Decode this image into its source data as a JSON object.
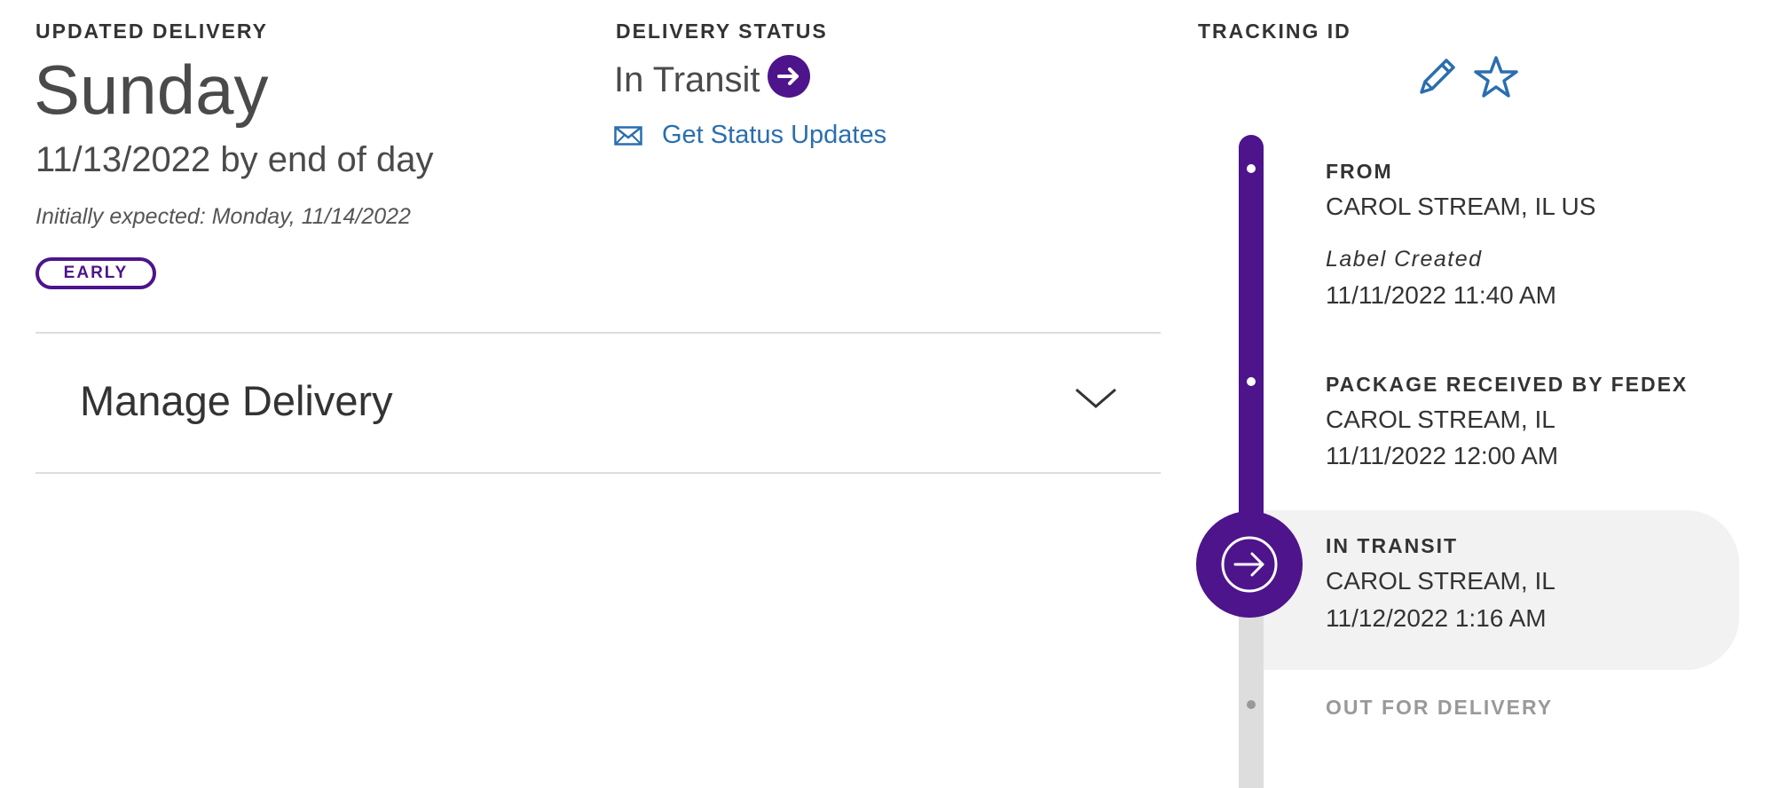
{
  "delivery": {
    "label": "UPDATED DELIVERY",
    "day": "Sunday",
    "date_line": "11/13/2022 by end of day",
    "initially_expected": "Initially expected: Monday, 11/14/2022",
    "badge": "EARLY"
  },
  "manage": {
    "label": "Manage Delivery"
  },
  "status": {
    "label": "DELIVERY STATUS",
    "value": "In Transit",
    "updates_link": "Get Status Updates"
  },
  "tracking": {
    "label": "TRACKING ID"
  },
  "timeline": {
    "events": [
      {
        "title": "FROM",
        "location": "CAROL STREAM, IL US",
        "note": "Label Created",
        "datetime": "11/11/2022 11:40 AM"
      },
      {
        "title": "PACKAGE RECEIVED BY FEDEX",
        "location": "CAROL STREAM, IL",
        "datetime": "11/11/2022 12:00 AM"
      },
      {
        "title": "IN TRANSIT",
        "location": "CAROL STREAM, IL",
        "datetime": "11/12/2022 1:16 AM"
      },
      {
        "title": "OUT FOR DELIVERY"
      }
    ]
  },
  "colors": {
    "brand_purple": "#4d148c",
    "link_blue": "#2a6eaf",
    "pending_gray": "#999999"
  },
  "icons": {
    "status": "arrow-right-circle-icon",
    "updates": "envelope-icon",
    "edit": "pencil-icon",
    "favorite": "star-icon",
    "expand": "chevron-down-icon"
  }
}
